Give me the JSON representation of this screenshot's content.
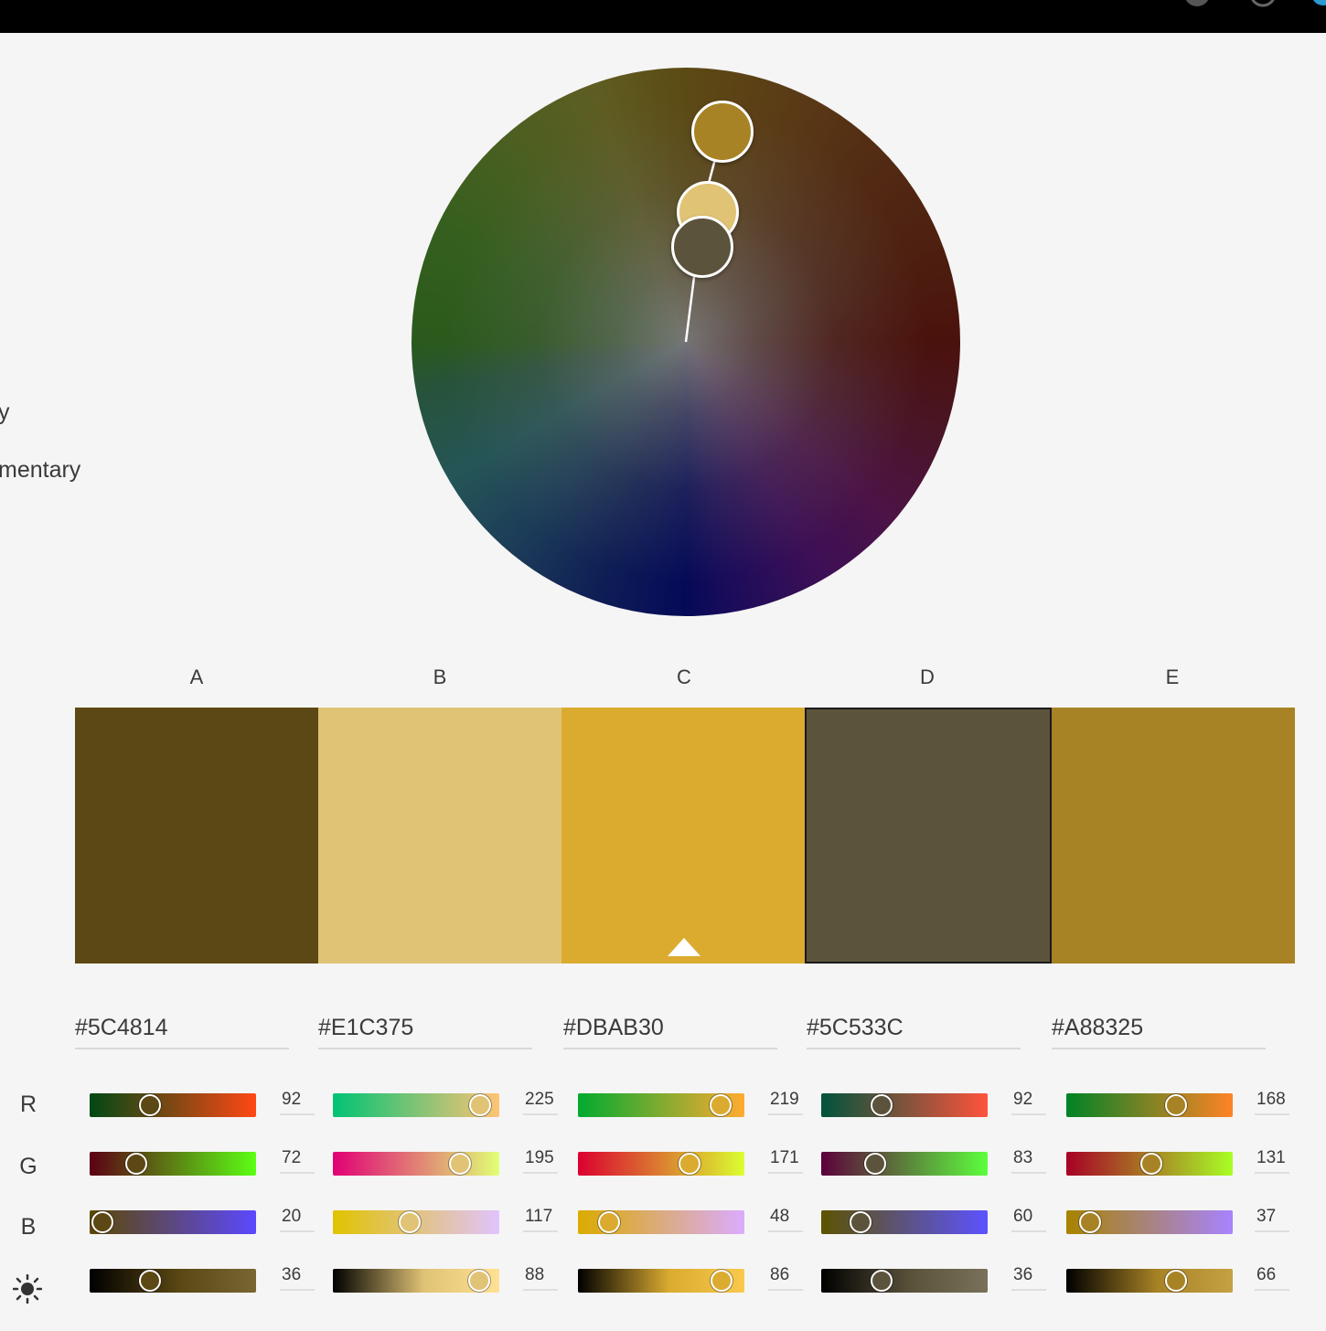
{
  "rules": {
    "items": [
      {
        "label": "y"
      },
      {
        "label": "mentary"
      }
    ]
  },
  "wheel": {
    "handles": [
      {
        "name": "E",
        "color": "#A88325"
      },
      {
        "name": "B",
        "color": "#E1C375"
      },
      {
        "name": "D",
        "color": "#5C533C"
      }
    ]
  },
  "swatches": [
    {
      "letter": "A",
      "hex": "#5C4814",
      "color": "#5C4814",
      "r": "92",
      "g": "72",
      "b": "20",
      "brightness": "36",
      "rv": 92,
      "gv": 72,
      "bv": 20,
      "lv": 36
    },
    {
      "letter": "B",
      "hex": "#E1C375",
      "color": "#E1C375",
      "r": "225",
      "g": "195",
      "b": "117",
      "brightness": "88",
      "rv": 225,
      "gv": 195,
      "bv": 117,
      "lv": 88
    },
    {
      "letter": "C",
      "hex": "#DBAB30",
      "color": "#DBAB30",
      "r": "219",
      "g": "171",
      "b": "48",
      "brightness": "86",
      "rv": 219,
      "gv": 171,
      "bv": 48,
      "lv": 86
    },
    {
      "letter": "D",
      "hex": "#5C533C",
      "color": "#5C533C",
      "r": "92",
      "g": "83",
      "b": "60",
      "brightness": "36",
      "rv": 92,
      "gv": 83,
      "bv": 60,
      "lv": 36
    },
    {
      "letter": "E",
      "hex": "#A88325",
      "color": "#A88325",
      "r": "168",
      "g": "131",
      "b": "37",
      "brightness": "66",
      "rv": 168,
      "gv": 131,
      "bv": 37,
      "lv": 66
    }
  ],
  "selected_swatch": "D",
  "base_swatch": "C",
  "channels": {
    "r_label": "R",
    "g_label": "G",
    "b_label": "B",
    "brightness_icon": "sun-icon"
  }
}
